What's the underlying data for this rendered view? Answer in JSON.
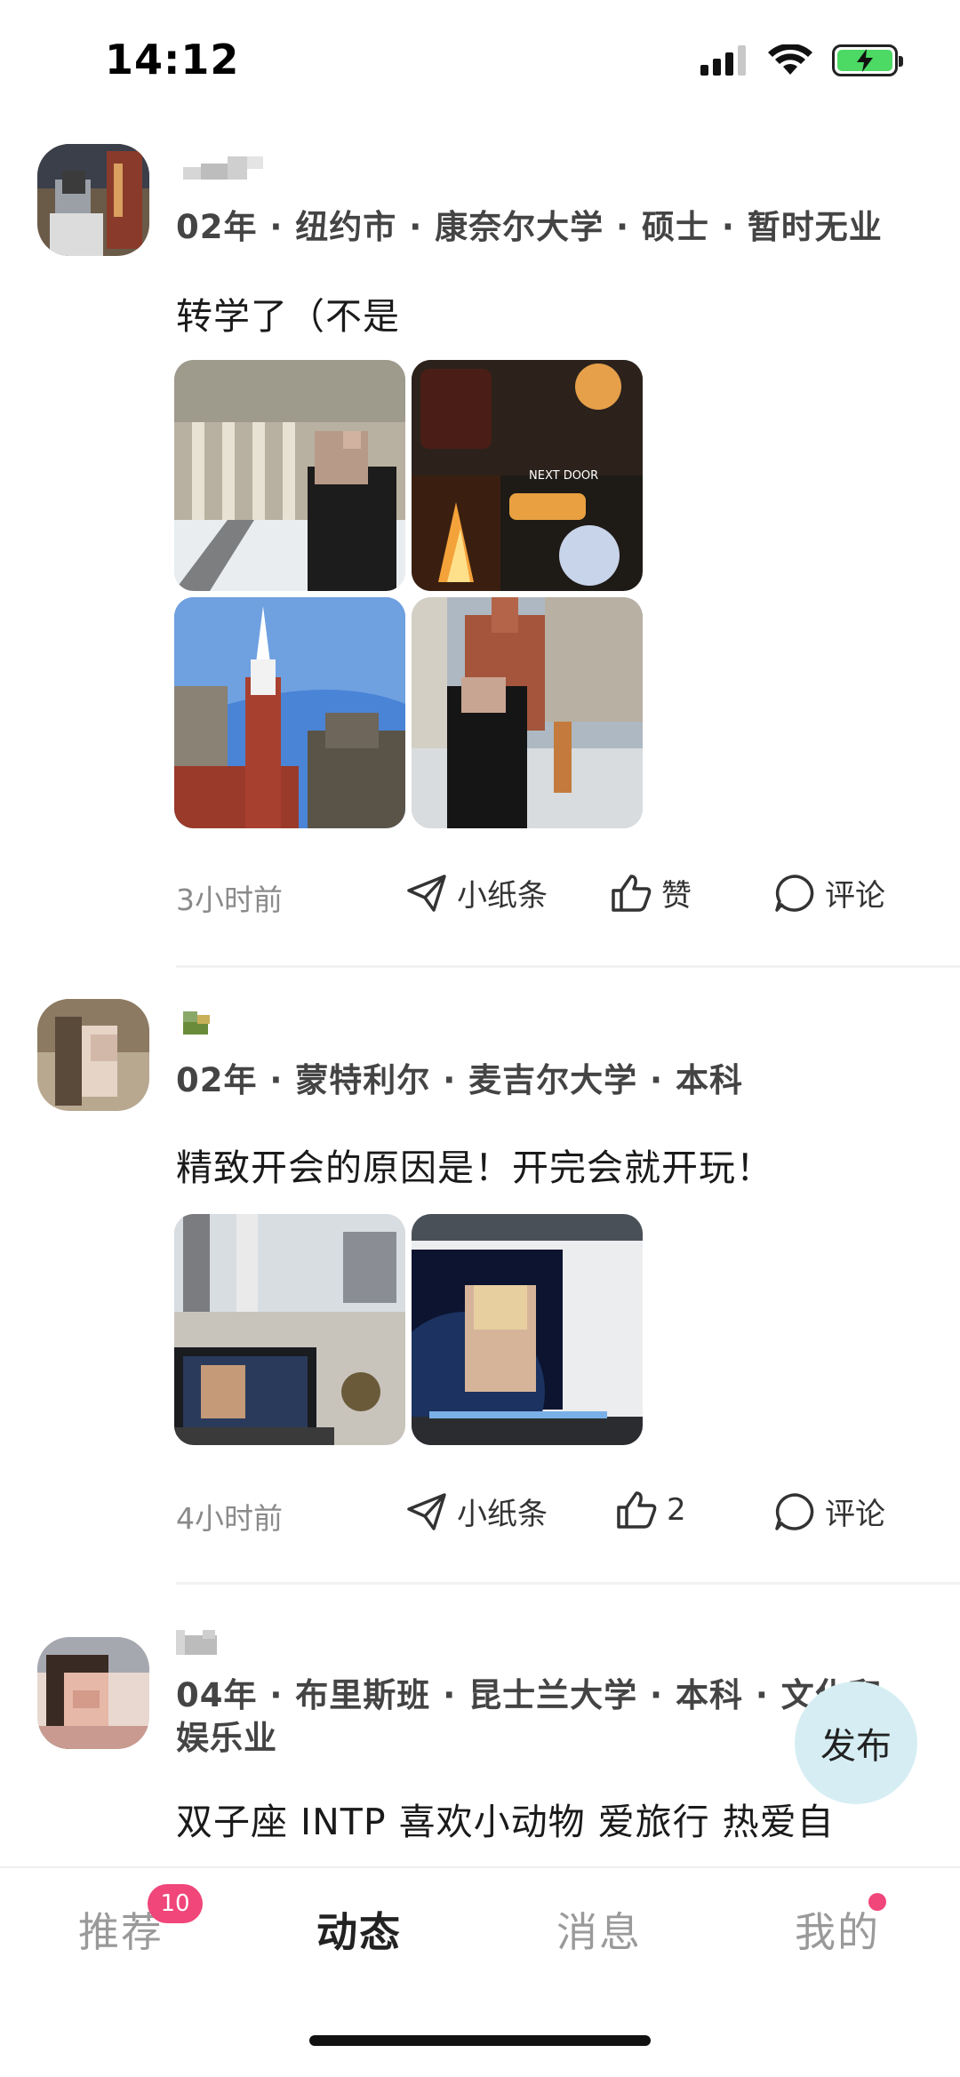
{
  "status_bar": {
    "time": "14:12"
  },
  "posts": [
    {
      "meta": "02年 · 纽约市 · 康奈尔大学 · 硕士 · 暂时无业",
      "content": "转学了（不是",
      "time": "3小时前",
      "actions": {
        "note": "小纸条",
        "like": "赞",
        "comment": "评论"
      },
      "photo_overlay": "NEXT DOOR"
    },
    {
      "meta": "02年 · 蒙特利尔 · 麦吉尔大学 · 本科",
      "content": "精致开会的原因是！开完会就开玩！",
      "time": "4小时前",
      "actions": {
        "note": "小纸条",
        "like": "2",
        "comment": "评论"
      }
    },
    {
      "meta_line1": "04年 · 布里斯班 · 昆士兰大学 · 本科 · 文化和",
      "meta_line2": "娱乐业",
      "content": "双子座 INTP 喜欢小动物 爱旅行 热爱自"
    }
  ],
  "publish_button": "发布",
  "tabs": [
    {
      "label": "推荐",
      "badge": "10"
    },
    {
      "label": "动态"
    },
    {
      "label": "消息"
    },
    {
      "label": "我的"
    }
  ],
  "colors": {
    "accent_pink": "#f0467a",
    "publish_bg": "#d6eef3"
  }
}
